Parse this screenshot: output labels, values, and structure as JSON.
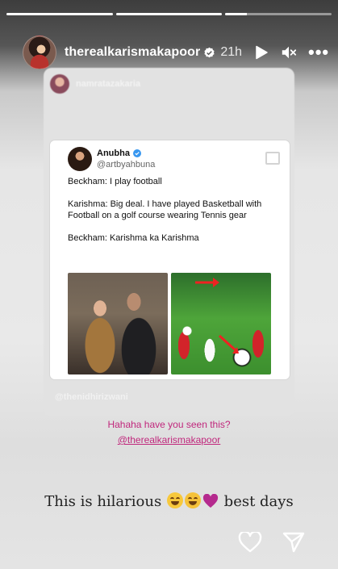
{
  "story": {
    "progress_segments": [
      1,
      1,
      0.2
    ],
    "header": {
      "username": "therealkarismakapoor",
      "time": "21h",
      "more": "•••",
      "icons": [
        "verified-icon",
        "play-icon",
        "mute-icon",
        "more-icon"
      ]
    },
    "repost": {
      "original_user": "namratazakaria",
      "footer_handle": "@thenidhirizwani"
    },
    "tweet": {
      "name": "Anubha",
      "handle": "@artbyahbuna",
      "lines": [
        "Beckham: I play football",
        "Karishma: Big deal. I have played Basketball with Football on a golf course wearing Tennis gear",
        "Beckham: Karishma ka Karishma"
      ]
    },
    "caption": {
      "line1": "Hahaha have you seen this?",
      "line2": "@therealkarismakapoor"
    },
    "main_text": {
      "before": "This is hilarious",
      "after": "best days"
    },
    "footer_icons": [
      "heart-icon",
      "send-icon"
    ],
    "colors": {
      "caption": "#c0277c",
      "verified": "#3897f0",
      "emoji_heart": "#b52a8e"
    }
  }
}
